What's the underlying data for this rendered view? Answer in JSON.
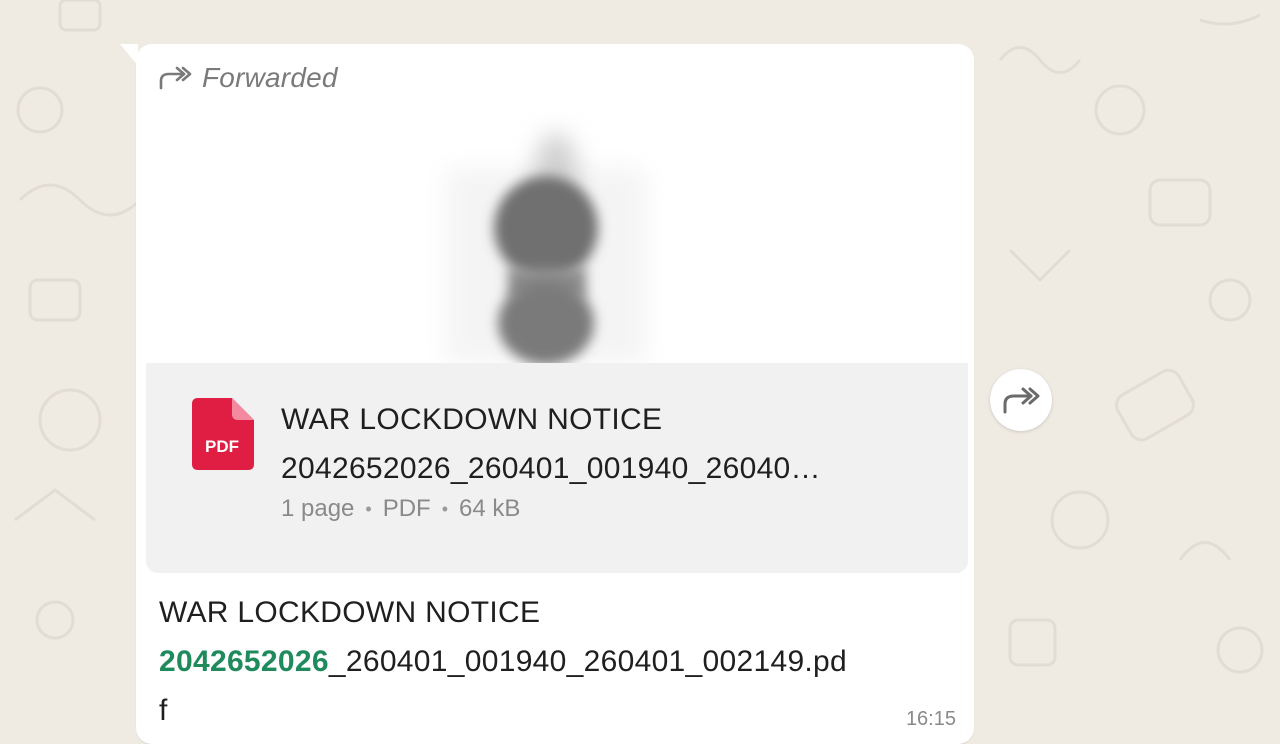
{
  "message": {
    "forwarded_label": "Forwarded",
    "document": {
      "title_line1": "WAR LOCKDOWN NOTICE",
      "title_line2": "2042652026_260401_001940_26040…",
      "file_type_badge": "PDF",
      "pages": "1 page",
      "type": "PDF",
      "size": "64 kB",
      "separator": "•"
    },
    "caption": {
      "line1": "WAR LOCKDOWN NOTICE",
      "phone_link": "2042652026",
      "line2_rest": "_260401_001940_260401_002149.pd",
      "line3": "f"
    },
    "time": "16:15"
  },
  "icons": {
    "forwarded": "forwarded-icon",
    "pdf": "pdf-file-icon",
    "forward_action": "forward-arrow-icon"
  },
  "colors": {
    "chat_background": "#efeae2",
    "bubble": "#ffffff",
    "document_card": "#f1f1f1",
    "pdf_red": "#e01e43",
    "link_green": "#1f8a5c",
    "meta_gray": "#8a8a8a"
  }
}
